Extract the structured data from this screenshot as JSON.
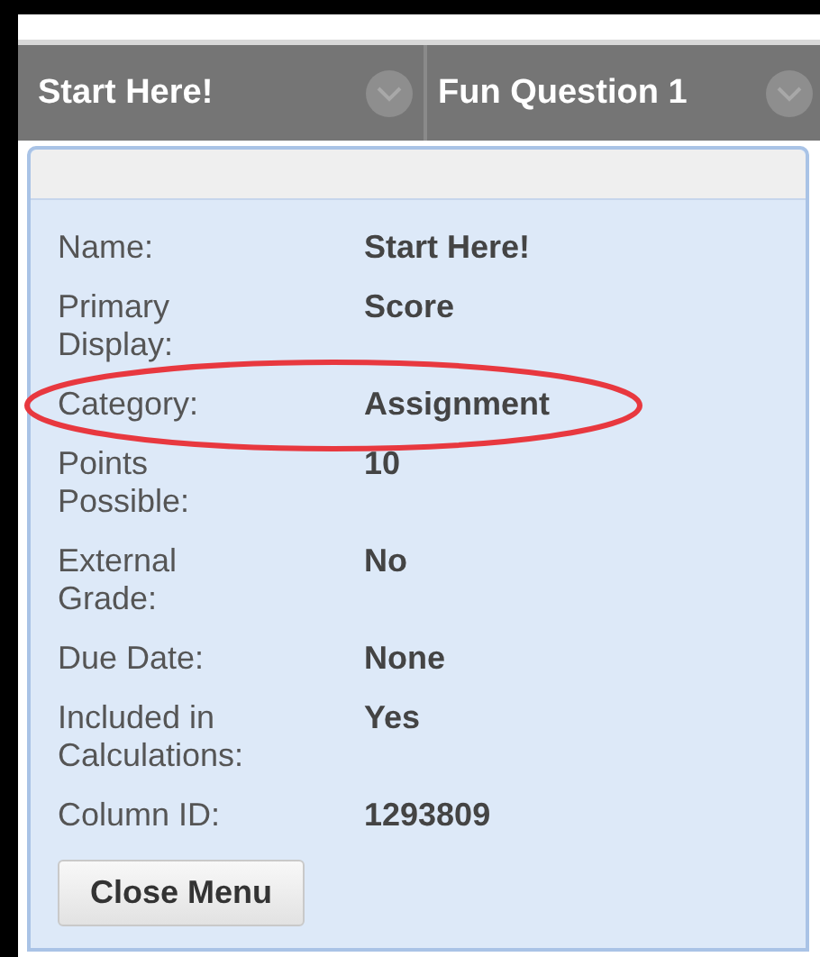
{
  "columns": [
    {
      "title": "Start Here!"
    },
    {
      "title": "Fun Question 1"
    }
  ],
  "menu": {
    "rows": [
      {
        "label": "Name:",
        "value": "Start Here!",
        "highlighted": false
      },
      {
        "label": "Primary Display:",
        "value": "Score",
        "highlighted": false
      },
      {
        "label": "Category:",
        "value": "Assignment",
        "highlighted": true
      },
      {
        "label": "Points Possible:",
        "value": "10",
        "highlighted": false
      },
      {
        "label": "External Grade:",
        "value": "No",
        "highlighted": false
      },
      {
        "label": "Due Date:",
        "value": "None",
        "highlighted": false
      },
      {
        "label": "Included in Calculations:",
        "value": "Yes",
        "highlighted": false
      },
      {
        "label": "Column ID:",
        "value": "1293809",
        "highlighted": false
      }
    ],
    "close_button": "Close Menu"
  }
}
